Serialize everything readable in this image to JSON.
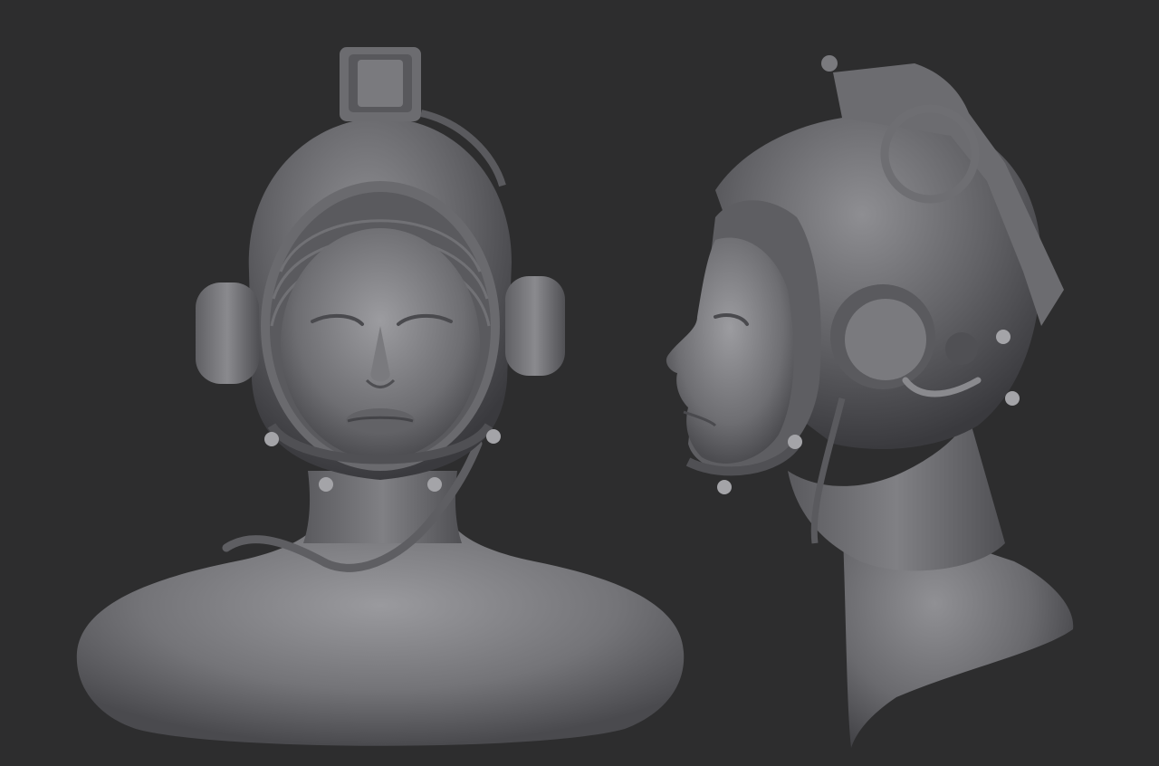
{
  "scene": {
    "background_color": "#2d2d2e",
    "material_color": "#8a8a8e",
    "subjects": [
      {
        "id": "front-bust",
        "view": "front"
      },
      {
        "id": "side-bust",
        "view": "profile"
      }
    ]
  }
}
